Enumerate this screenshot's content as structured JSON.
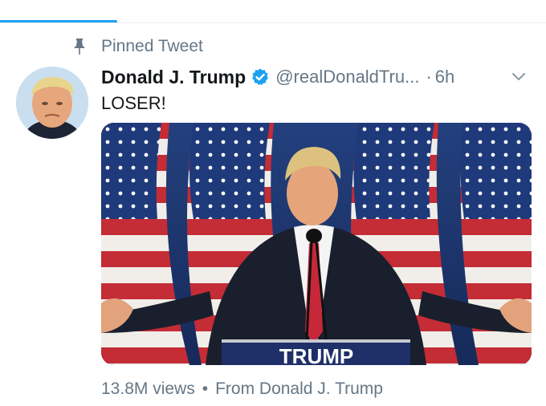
{
  "pinned": {
    "label": "Pinned Tweet",
    "icon": "pin-icon"
  },
  "tweet": {
    "display_name": "Donald J. Trump",
    "verified": true,
    "handle": "@realDonaldTru...",
    "separator": "·",
    "timestamp": "6h",
    "text": "LOSER!",
    "podium_sign": "TRUMP"
  },
  "footer": {
    "views": "13.8M views",
    "separator": "•",
    "source": "From Donald J. Trump"
  },
  "colors": {
    "accent": "#1da1f2",
    "secondary_text": "#657786",
    "primary_text": "#14171a"
  }
}
